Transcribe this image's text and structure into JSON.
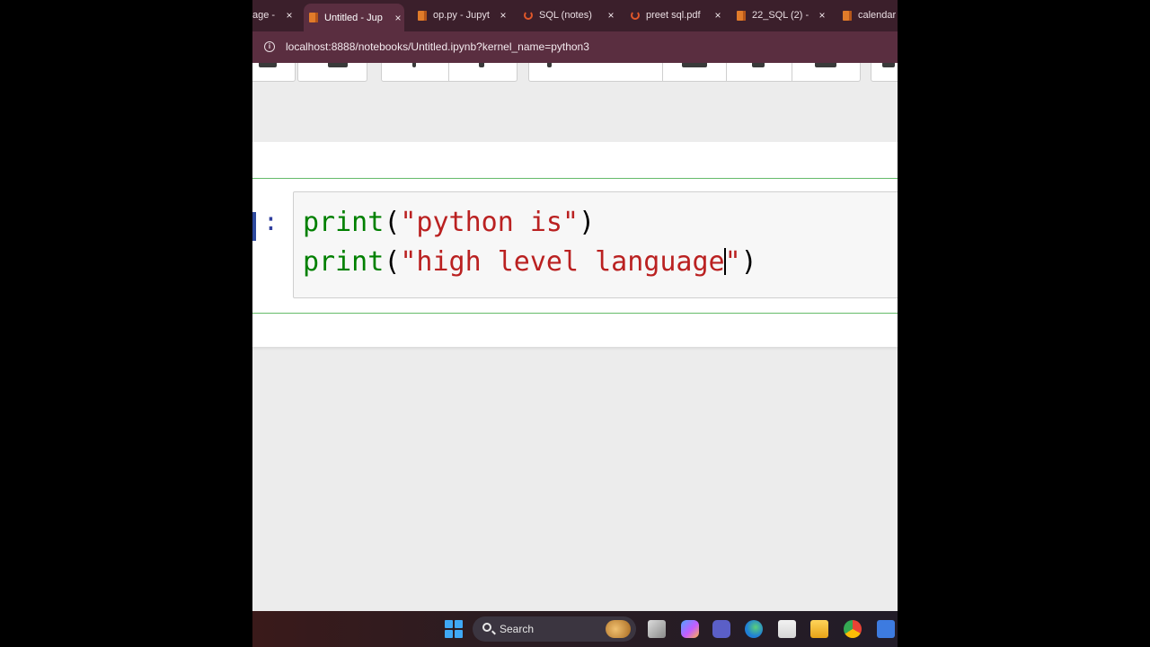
{
  "browser": {
    "tabs": [
      {
        "label": "age -",
        "icon": "page-icon",
        "active": false
      },
      {
        "label": "Untitled - Jup",
        "icon": "jupyter-book-icon",
        "active": true
      },
      {
        "label": "op.py - Jupyt",
        "icon": "jupyter-book-icon",
        "active": false
      },
      {
        "label": "SQL (notes)",
        "icon": "loading-spinner-icon",
        "active": false
      },
      {
        "label": "preet sql.pdf",
        "icon": "loading-spinner-icon",
        "active": false
      },
      {
        "label": "22_SQL (2) -",
        "icon": "jupyter-book-icon",
        "active": false
      },
      {
        "label": "calendar -",
        "icon": "jupyter-book-icon",
        "active": false
      }
    ],
    "tab_close_glyph": "×",
    "address_url": "localhost:8888/notebooks/Untitled.ipynb?kernel_name=python3",
    "accent_color": "#5a2e40"
  },
  "notebook": {
    "cell": {
      "prompt": ":",
      "line1": {
        "func": "print",
        "open": "(",
        "str": "\"python is\"",
        "close": ")"
      },
      "line2": {
        "func": "print",
        "open": "(",
        "str_before_caret": "\"high level language",
        "str_after_caret": "\"",
        "close": ")"
      }
    },
    "colors": {
      "keyword": "#008000",
      "string": "#ba2121",
      "cell_border": "#66bb6a",
      "prompt": "#303f9f"
    }
  },
  "taskbar": {
    "search_label": "Search",
    "icons": [
      "windows-start-icon",
      "search-icon",
      "task-view-icon",
      "copilot-icon",
      "teams-icon",
      "edge-icon",
      "store-icon",
      "file-explorer-icon",
      "chrome-icon",
      "visual-studio-icon"
    ]
  }
}
